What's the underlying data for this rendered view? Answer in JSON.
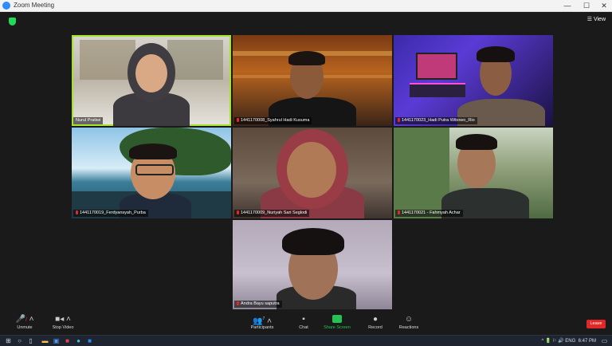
{
  "window": {
    "title": "Zoom Meeting",
    "minimize": "—",
    "maximize": "☐",
    "close": "✕"
  },
  "view_label": "View",
  "participants": [
    {
      "name": "Nurul Pratiwi"
    },
    {
      "name": "1441170008_Syahrul Hadi Kusuma"
    },
    {
      "name": "1441170023_Hadi Putra Wibowo_Rio"
    },
    {
      "name": "1441170019_Ferdyansyah_Purba"
    },
    {
      "name": "1441170009_Nuriyah Sari Seglodi"
    },
    {
      "name": "1441170021 - Fahmyah Achar"
    },
    {
      "name": "Andra Bayu saputra"
    }
  ],
  "toolbar": {
    "unmute": "Unmute",
    "stop_video": "Stop Video",
    "participants": "Participants",
    "participants_count": "7",
    "chat": "Chat",
    "share": "Share Screen",
    "record": "Record",
    "reactions": "Reactions",
    "leave": "Leave"
  },
  "tray": {
    "status": "^ 🔋 ⚐ 🔊 ENG",
    "time": "6:47 PM"
  }
}
